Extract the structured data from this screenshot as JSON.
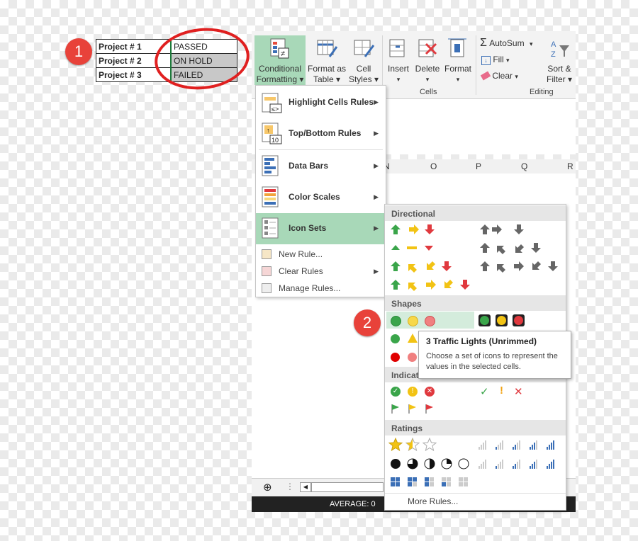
{
  "projects": [
    {
      "name": "Project # 1",
      "status": "PASSED"
    },
    {
      "name": "Project # 2",
      "status": "ON HOLD"
    },
    {
      "name": "Project # 3",
      "status": "FAILED"
    }
  ],
  "callouts": {
    "step1": "1",
    "step2": "2"
  },
  "ribbon": {
    "conditional_formatting": [
      "Conditional",
      "Formatting ▾"
    ],
    "format_as_table": [
      "Format as",
      "Table ▾"
    ],
    "cell_styles": [
      "Cell",
      "Styles ▾"
    ],
    "insert": "Insert",
    "delete": "Delete",
    "format": "Format",
    "cells_group": "Cells",
    "autosum": "AutoSum",
    "fill": "Fill",
    "clear": "Clear",
    "sort_filter": [
      "Sort &",
      "Filter ▾"
    ],
    "editing_group": "Editing"
  },
  "columns": [
    "N",
    "O",
    "P",
    "Q",
    "R"
  ],
  "menu": {
    "highlight": "Highlight Cells Rules",
    "topbottom": "Top/Bottom Rules",
    "databars": "Data Bars",
    "colorscales": "Color Scales",
    "iconsets": "Icon Sets",
    "newrule": "New Rule...",
    "clearrules": "Clear Rules",
    "managerules": "Manage Rules..."
  },
  "submenu": {
    "directional": "Directional",
    "shapes": "Shapes",
    "indicators": "Indicat",
    "ratings": "Ratings",
    "more_rules": "More Rules..."
  },
  "tooltip": {
    "title": "3 Traffic Lights (Unrimmed)",
    "description": "Choose a set of icons to represent the values in the selected cells."
  },
  "status": {
    "average": "AVERAGE: 0"
  },
  "colors": {
    "green": "#3aa54a",
    "yellow": "#f2c314",
    "red": "#e0393e",
    "active": "#a8d8b8"
  }
}
